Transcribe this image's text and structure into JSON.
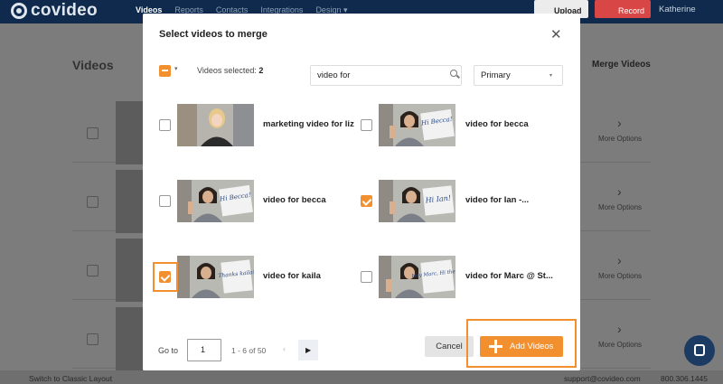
{
  "app": {
    "logo_text": "covideo",
    "nav": [
      "Videos",
      "Reports",
      "Contacts",
      "Integrations",
      "Design"
    ],
    "design_caret": "▾",
    "upload_label": "Upload",
    "record_label": "Record",
    "user_name": "Katherine"
  },
  "page": {
    "heading": "Videos",
    "merge_label": "Merge Videos",
    "more_options": "More Options",
    "chevron": "›"
  },
  "footer": {
    "switch_label": "Switch to Classic Layout",
    "email": "support@covideo.com",
    "phone": "800.306.1445"
  },
  "modal": {
    "title": "Select videos to merge",
    "close": "✕",
    "master_caret": "▾",
    "selected_label": "Videos selected:",
    "selected_count": "2",
    "search_value": "video for",
    "folder_select": "Primary",
    "select_caret": "▾",
    "videos": [
      {
        "title": "marketing video for liz",
        "checked": false
      },
      {
        "title": "video for becca",
        "checked": false
      },
      {
        "title": "video for becca",
        "checked": false
      },
      {
        "title": "video for Ian -...",
        "checked": true
      },
      {
        "title": "video for kaila",
        "checked": true
      },
      {
        "title": "video for Marc @ St...",
        "checked": false
      }
    ],
    "thumb_signs": [
      "",
      "Hi Becca!",
      "Hi Becca!",
      "Hi Ian!",
      "Thanks kaila!",
      "Hey Marc, Hi there!"
    ],
    "goto_label": "Go to",
    "goto_value": "1",
    "range": "1 - 6 of 50",
    "prev": "‹",
    "next": "▶",
    "cancel_label": "Cancel",
    "add_label": "Add Videos"
  },
  "colors": {
    "accent": "#f2902f",
    "nav_bg": "#0f2a4d"
  }
}
